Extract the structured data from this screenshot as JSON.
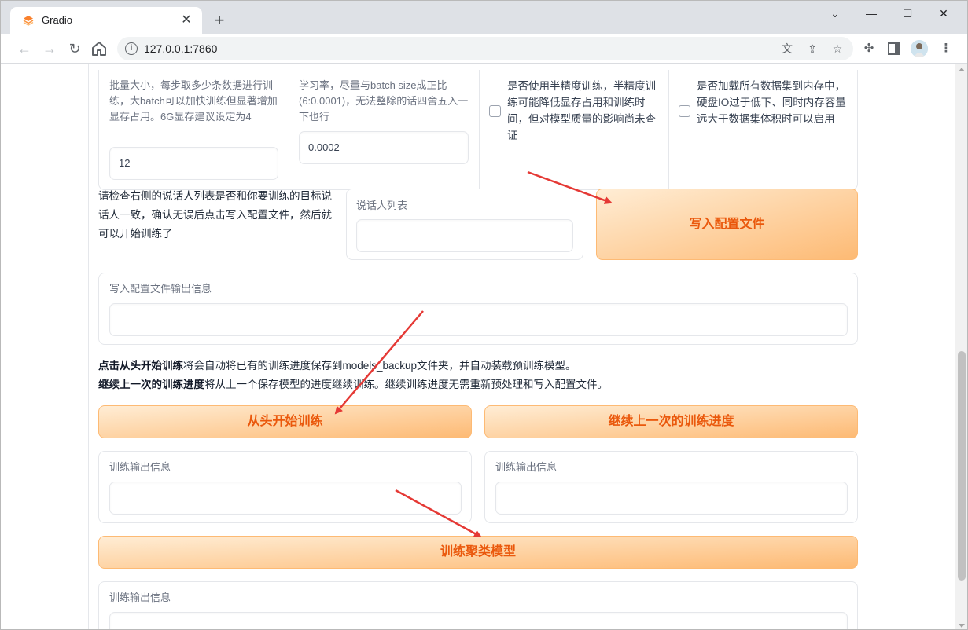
{
  "browser": {
    "tab_title": "Gradio",
    "tab_close": "✕",
    "new_tab": "+",
    "url": "127.0.0.1:7860",
    "window_controls": [
      "⌄",
      "—",
      "☐",
      "✕"
    ]
  },
  "training_params": {
    "batch_size": {
      "label": "批量大小，每步取多少条数据进行训练，大batch可以加快训练但显著增加显存占用。6G显存建议设定为4",
      "value": "12"
    },
    "learning_rate": {
      "label": "学习率，尽量与batch size成正比(6:0.0001)，无法整除的话四舍五入一下也行",
      "value": "0.0002"
    },
    "half_precision": {
      "label": "是否使用半精度训练，半精度训练可能降低显存占用和训练时间，但对模型质量的影响尚未查证",
      "checked": false
    },
    "load_all_to_memory": {
      "label": "是否加载所有数据集到内存中，硬盘IO过于低下、同时内存容量远大于数据集体积时可以启用",
      "checked": false
    }
  },
  "speaker_check": {
    "instruction": "请检查右侧的说话人列表是否和你要训练的目标说话人一致，确认无误后点击写入配置文件，然后就可以开始训练了",
    "speaker_list_label": "说话人列表",
    "speaker_list_value": "",
    "write_config_button": "写入配置文件"
  },
  "config_output": {
    "label": "写入配置文件输出信息",
    "value": ""
  },
  "training_desc": {
    "line1_bold": "点击从头开始训练",
    "line1_rest": "将会自动将已有的训练进度保存到models_backup文件夹，并自动装载预训练模型。",
    "line2_bold": "继续上一次的训练进度",
    "line2_rest": "将从上一个保存模型的进度继续训练。继续训练进度无需重新预处理和写入配置文件。"
  },
  "buttons": {
    "train_from_scratch": "从头开始训练",
    "continue_training": "继续上一次的训练进度",
    "train_cluster": "训练聚类模型"
  },
  "outputs": {
    "scratch_output_label": "训练输出信息",
    "continue_output_label": "训练输出信息",
    "cluster_output_label": "训练输出信息"
  },
  "colors": {
    "accent": "#ea580c",
    "button_from": "#ffedd5",
    "button_to": "#fdba74",
    "annotation_arrow": "#e53935"
  }
}
